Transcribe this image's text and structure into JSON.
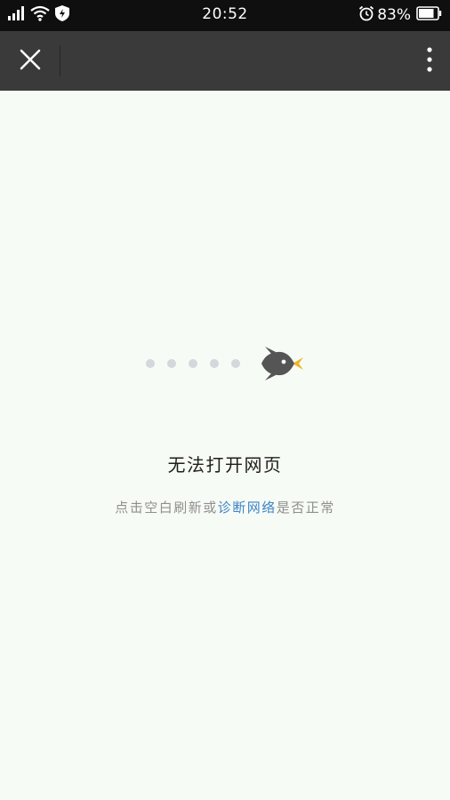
{
  "status_bar": {
    "time": "20:52",
    "battery": "83%",
    "icons": [
      "signal-icon",
      "wifi-icon",
      "shield-icon",
      "alarm-icon",
      "battery-icon"
    ]
  },
  "toolbar": {
    "close_icon": "close-icon",
    "more_icon": "more-vertical-icon"
  },
  "error": {
    "title": "无法打开网页",
    "hint_prefix": "点击空白刷新或",
    "hint_link": "诊断网络",
    "hint_suffix": "是否正常"
  },
  "colors": {
    "background": "#f7fbf5",
    "toolbar": "#3a3a3a",
    "status_bar": "#0f0f0f",
    "link": "#3e83c9",
    "hint_text": "#8f8f8f",
    "rocket_body": "#555555",
    "rocket_flame": "#f0b429",
    "loading_dots": "#d4d7dc"
  }
}
